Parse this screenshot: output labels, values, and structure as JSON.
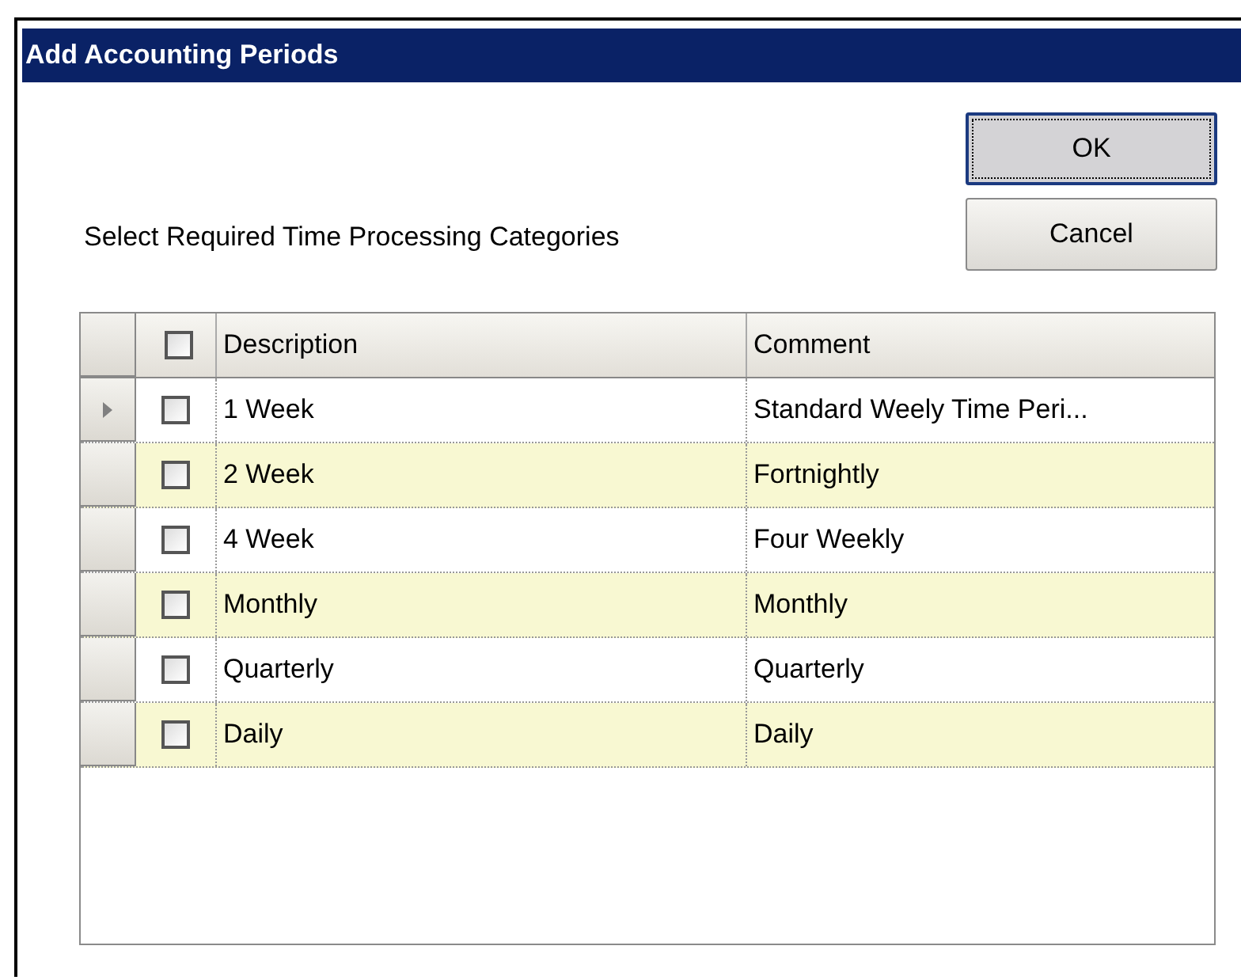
{
  "window": {
    "title": "Add Accounting Periods"
  },
  "buttons": [
    {
      "label": "OK",
      "focused": true
    },
    {
      "label": "Cancel",
      "focused": false
    }
  ],
  "instruction": "Select Required Time Processing Categories",
  "table": {
    "header_checkbox": {
      "checked": false
    },
    "columns": [
      "Description",
      "Comment"
    ],
    "rows": [
      {
        "current": true,
        "checked": false,
        "description": "1 Week",
        "comment": "Standard Weely Time Peri..."
      },
      {
        "current": false,
        "checked": false,
        "description": "2 Week",
        "comment": "Fortnightly"
      },
      {
        "current": false,
        "checked": false,
        "description": "4 Week",
        "comment": "Four Weekly"
      },
      {
        "current": false,
        "checked": false,
        "description": "Monthly",
        "comment": "Monthly"
      },
      {
        "current": false,
        "checked": false,
        "description": "Quarterly",
        "comment": "Quarterly"
      },
      {
        "current": false,
        "checked": false,
        "description": "Daily",
        "comment": "Daily"
      }
    ]
  }
}
